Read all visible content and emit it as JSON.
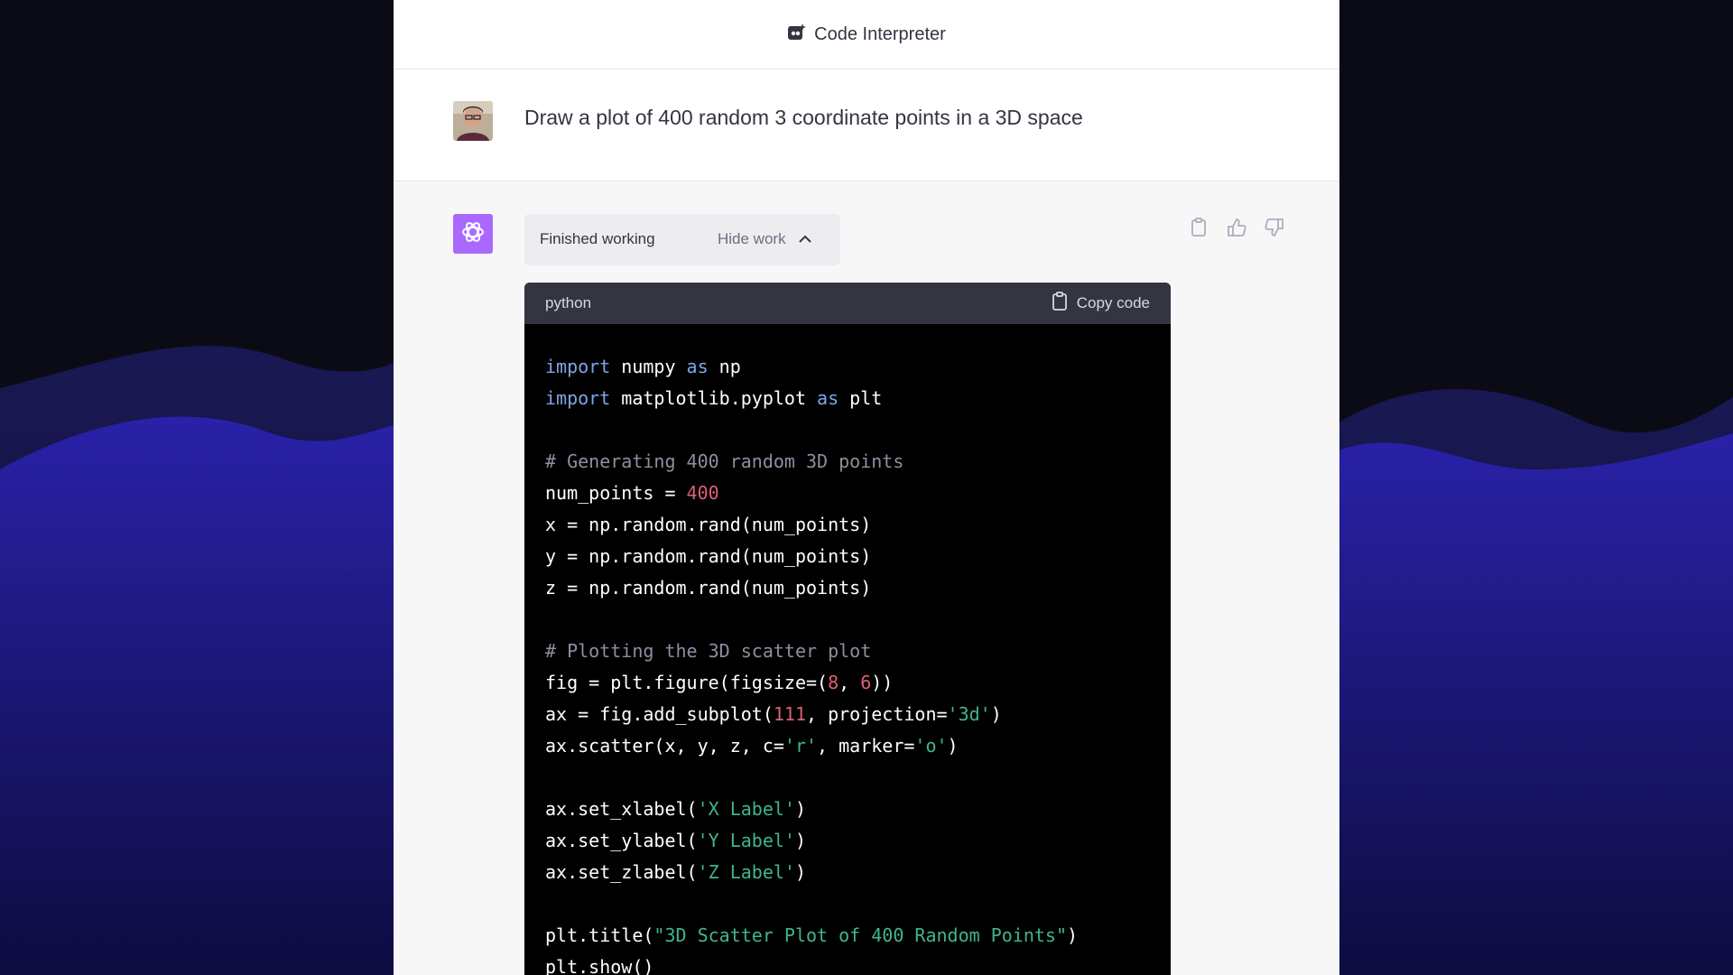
{
  "header": {
    "title": "Code Interpreter"
  },
  "user_message": {
    "text": "Draw a plot of 400 random 3 coordinate points in a 3D space"
  },
  "assistant": {
    "status_label": "Finished working",
    "toggle_label": "Hide work",
    "actions": [
      "copy-icon",
      "thumbs-up-icon",
      "thumbs-down-icon"
    ],
    "code_block": {
      "language": "python",
      "copy_label": "Copy code",
      "lines": [
        "import numpy as np",
        "import matplotlib.pyplot as plt",
        "",
        "# Generating 400 random 3D points",
        "num_points = 400",
        "x = np.random.rand(num_points)",
        "y = np.random.rand(num_points)",
        "z = np.random.rand(num_points)",
        "",
        "# Plotting the 3D scatter plot",
        "fig = plt.figure(figsize=(8, 6))",
        "ax = fig.add_subplot(111, projection='3d')",
        "ax.scatter(x, y, z, c='r', marker='o')",
        "",
        "ax.set_xlabel('X Label')",
        "ax.set_ylabel('Y Label')",
        "ax.set_zlabel('Z Label')",
        "",
        "plt.title(\"3D Scatter Plot of 400 Random Points\")",
        "plt.show()"
      ]
    }
  },
  "colors": {
    "accent_gpt": "#ab68ff",
    "keyword": "#7aa7e8",
    "comment": "#8e8ea0",
    "number": "#e05d77",
    "string": "#3fb68b"
  }
}
